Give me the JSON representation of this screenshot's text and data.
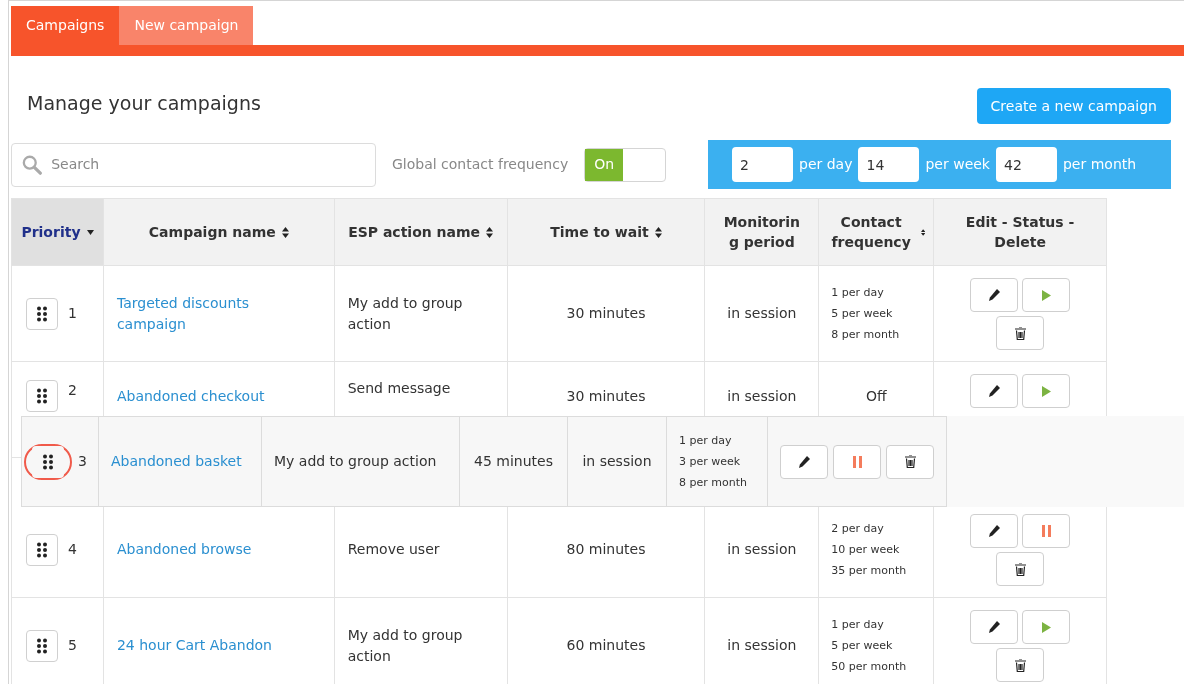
{
  "tabs": [
    {
      "label": "Campaigns",
      "selected": true
    },
    {
      "label": "New campaign",
      "selected": false
    }
  ],
  "title": "Manage your campaigns",
  "create_button": "Create a new campaign",
  "search": {
    "placeholder": "Search"
  },
  "global_frequency": {
    "label": "Global contact frequency",
    "toggle": {
      "label": "On",
      "on": true
    }
  },
  "limits": [
    {
      "value": "2",
      "unit": "per day"
    },
    {
      "value": "14",
      "unit": "per week"
    },
    {
      "value": "42",
      "unit": "per month"
    }
  ],
  "table": {
    "columns": [
      {
        "label": "Priority",
        "sortable": true,
        "sorted": true
      },
      {
        "label": "Campaign name",
        "sortable": true,
        "sorted": false
      },
      {
        "label": "ESP action name",
        "sortable": true,
        "sorted": false
      },
      {
        "label": "Time to wait",
        "sortable": true,
        "sorted": false
      },
      {
        "label": "Monitoring period",
        "sortable": false,
        "sorted": false
      },
      {
        "label": "Contact frequency",
        "sortable": true,
        "sorted": false
      },
      {
        "label": "Edit - Status - Delete",
        "sortable": false,
        "sorted": false
      }
    ],
    "rows": [
      {
        "priority": "1",
        "name": "Targeted discounts campaign",
        "esp": "My add to group action",
        "wait": "30 minutes",
        "monitoring": "in session",
        "frequency": [
          "1 per day",
          "5 per week",
          "8 per month"
        ],
        "running": false,
        "delete_visible": true
      },
      {
        "priority": "2",
        "name": "Abandoned checkout",
        "esp": "Send message",
        "wait": "30 minutes",
        "monitoring": "in session",
        "frequency": [
          "Off"
        ],
        "running": false,
        "delete_visible": false
      },
      {
        "priority": "4",
        "name": "Abandoned browse",
        "esp": "Remove user",
        "wait": "80 minutes",
        "monitoring": "in session",
        "frequency": [
          "2 per day",
          "10 per week",
          "35 per month"
        ],
        "running": true,
        "delete_visible": true
      },
      {
        "priority": "5",
        "name": "24 hour Cart Abandon",
        "esp": "My add to group action",
        "wait": "60 minutes",
        "monitoring": "in session",
        "frequency": [
          "1 per day",
          "5 per week",
          "50 per month"
        ],
        "running": false,
        "delete_visible": true
      }
    ]
  },
  "dragged_row": {
    "priority": "3",
    "name": "Abandoned basket",
    "esp": "My add to group action",
    "wait": "45 minutes",
    "monitoring": "in session",
    "frequency": [
      "1 per day",
      "3 per week",
      "8 per month"
    ],
    "running": true,
    "delete_visible": true
  }
}
